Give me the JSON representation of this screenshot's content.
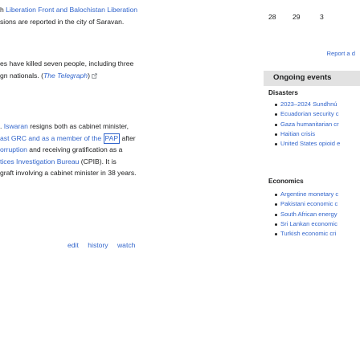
{
  "article": {
    "para1": {
      "line1_text": "h ",
      "line1_link": "Liberation Front and Balochistan Liberation",
      "line2": "sions are reported in the city of Saravan."
    },
    "para2": {
      "line1": "es have killed seven people, including three",
      "line2_text": "gn nationals. (",
      "line2_source": "The Telegraph",
      "line2_close": ")"
    },
    "para3": {
      "line1_pre": ". ",
      "line1_link": "Iswaran",
      "line1_post": " resigns both as cabinet minister,",
      "line2_pre": "ast GRC and as a member of the ",
      "line2_link": "PAP",
      "line2_post": " after",
      "line3_pre": "orruption",
      "line3_post": " and receiving gratification as a",
      "line4_pre": "tices Investigation Bureau",
      "line4_post": " (CPIB). It is",
      "line5": "graft involving a cabinet minister in 38 years."
    },
    "tools": {
      "edit": "edit",
      "history": "history",
      "watch": "watch"
    }
  },
  "sidebar": {
    "calendar_days": [
      "28",
      "29",
      "3"
    ],
    "report_link": "Report a d",
    "ongoing_title": "Ongoing events",
    "disasters": {
      "heading": "Disasters",
      "items": [
        "2023–2024 Sundhnú",
        "Ecuadorian security c",
        "Gaza humanitarian cr",
        "Haitian crisis",
        "United States opioid e"
      ]
    },
    "economics": {
      "heading": "Economics",
      "items": [
        "Argentine monetary c",
        "Pakistani economic c",
        "South African energy",
        "Sri Lankan economic",
        "Turkish economic cri"
      ]
    }
  },
  "colors": {
    "link": "#3366cc",
    "text": "#202122",
    "header_bg": "#e2e2e2"
  }
}
